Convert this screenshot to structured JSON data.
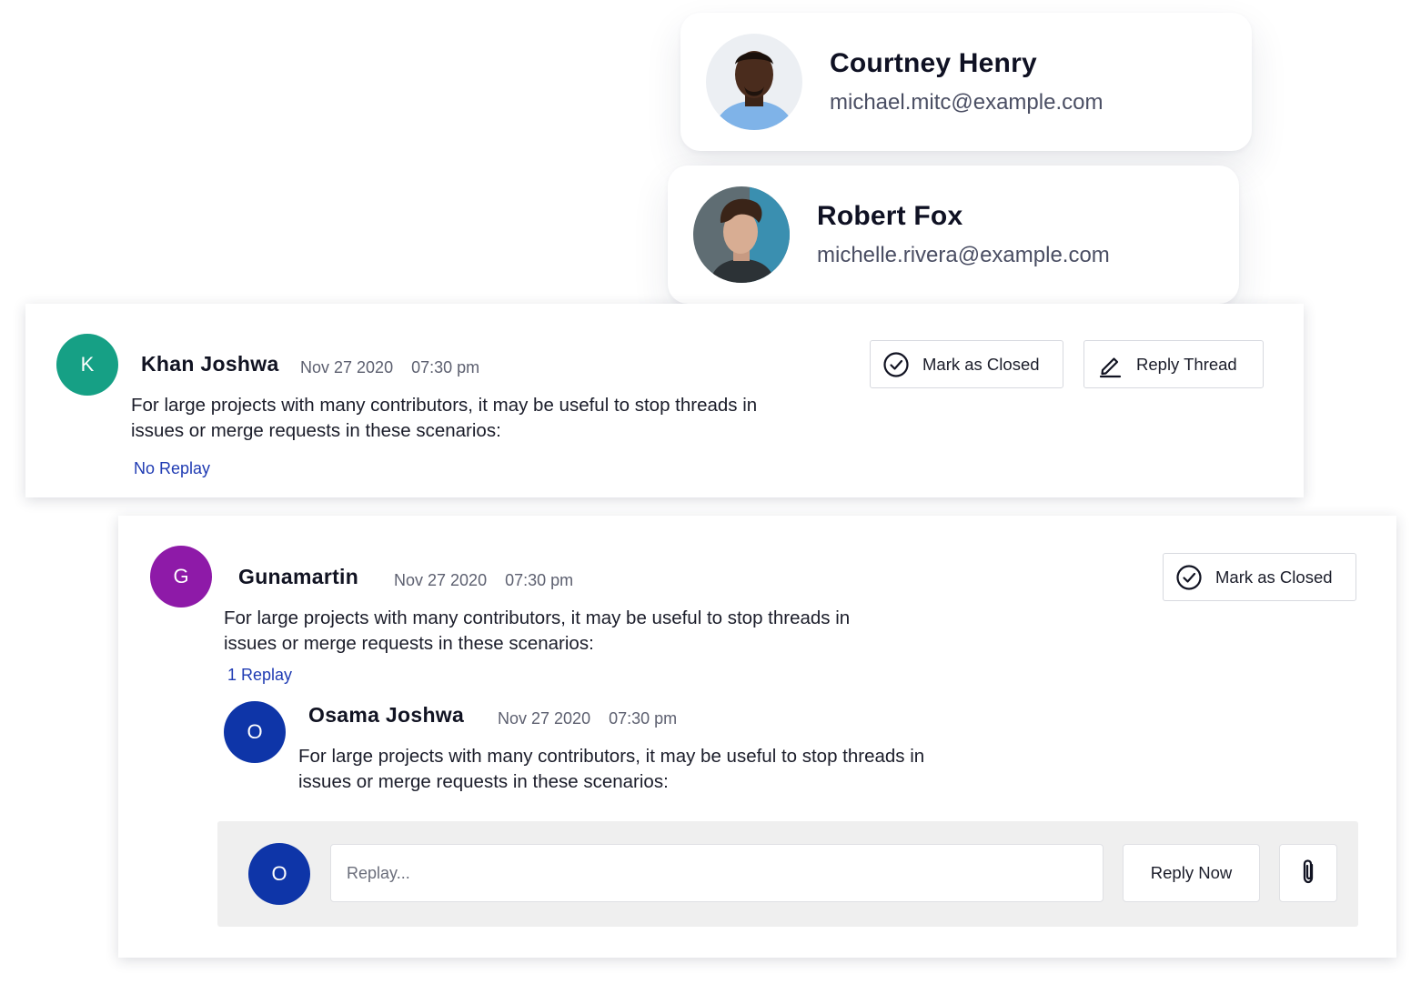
{
  "contacts": [
    {
      "name": "Courtney Henry",
      "email": "michael.mitc@example.com"
    },
    {
      "name": "Robert Fox",
      "email": "michelle.rivera@example.com"
    }
  ],
  "threads": [
    {
      "initial": "K",
      "avatar_color": "#16a085",
      "author": "Khan Joshwa",
      "date": "Nov 27 2020",
      "time": "07:30 pm",
      "message_line1": "For large projects with many contributors, it may be useful to stop threads in",
      "message_line2": "issues or merge requests in these scenarios:",
      "replies_label": "No Replay",
      "mark_closed_label": "Mark as Closed",
      "reply_thread_label": "Reply Thread"
    },
    {
      "initial": "G",
      "avatar_color": "#8e1aa8",
      "author": "Gunamartin",
      "date": "Nov 27 2020",
      "time": "07:30 pm",
      "message_line1": "For large projects with many contributors, it may be useful to stop threads in",
      "message_line2": "issues or merge requests in these scenarios:",
      "replies_label": "1 Replay",
      "mark_closed_label": "Mark as Closed",
      "reply": {
        "initial": "O",
        "avatar_color": "#0e35a8",
        "author": "Osama Joshwa",
        "date": "Nov 27 2020",
        "time": "07:30 pm",
        "message_line1": "For large projects with many contributors, it may be useful to stop threads in",
        "message_line2": "issues or merge requests in these scenarios:"
      },
      "composer": {
        "initial": "O",
        "avatar_color": "#0e35a8",
        "placeholder": "Replay...",
        "reply_now_label": "Reply Now",
        "attach_icon": "paperclip-icon"
      }
    }
  ],
  "icons": {
    "check": "check-circle-icon",
    "pencil": "pencil-icon",
    "clip": "paperclip-icon"
  }
}
